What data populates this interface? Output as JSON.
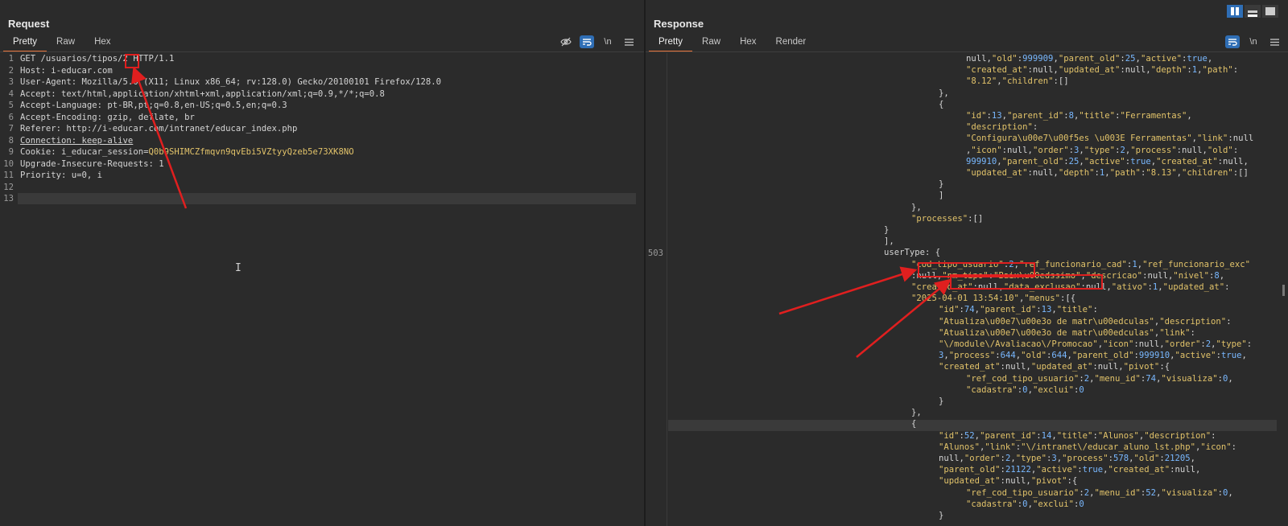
{
  "request": {
    "title": "Request",
    "tabs": [
      "Pretty",
      "Raw",
      "Hex"
    ],
    "icons": [
      "hide-icon",
      "wrap-icon",
      "newline-icon",
      "menu-icon"
    ],
    "newline_label": "\\n",
    "lines": [
      {
        "n": "1",
        "t": "GET /usuarios/tipos/2 HTTP/1.1"
      },
      {
        "n": "2",
        "t": "Host: i-educar.com"
      },
      {
        "n": "3",
        "t": "User-Agent: Mozilla/5.0 (X11; Linux x86_64; rv:128.0) Gecko/20100101 Firefox/128.0"
      },
      {
        "n": "4",
        "t": "Accept: text/html,application/xhtml+xml,application/xml;q=0.9,*/*;q=0.8"
      },
      {
        "n": "5",
        "t": "Accept-Language: pt-BR,pt;q=0.8,en-US;q=0.5,en;q=0.3"
      },
      {
        "n": "6",
        "t": "Accept-Encoding: gzip, deflate, br"
      },
      {
        "n": "7",
        "t": "Referer: http://i-educar.com/intranet/educar_index.php"
      },
      {
        "n": "8",
        "t": "Connection: keep-alive"
      },
      {
        "n": "9",
        "t": "Cookie: i_educar_session=",
        "v": "Q0b9SHIMCZfmqvn9qvEbi5VZtyyQzeb5e73XK8NO"
      },
      {
        "n": "10",
        "t": "Upgrade-Insecure-Requests: 1"
      },
      {
        "n": "11",
        "t": "Priority: u=0, i"
      },
      {
        "n": "12",
        "t": ""
      },
      {
        "n": "13",
        "t": ""
      }
    ]
  },
  "response": {
    "title": "Response",
    "tabs": [
      "Pretty",
      "Raw",
      "Hex",
      "Render"
    ],
    "newline_label": "\\n",
    "line_number": "503",
    "lines": [
      "null,\"old\":999909,\"parent_old\":25,\"active\":true,",
      "\"created_at\":null,\"updated_at\":null,\"depth\":1,\"path\":",
      "\"8.12\",\"children\":[]",
      "},",
      "{",
      "\"id\":13,\"parent_id\":8,\"title\":\"Ferramentas\",",
      "\"description\":",
      "\"Configura\\u00e7\\u00f5es \\u003E Ferramentas\",\"link\":null",
      ",\"icon\":null,\"order\":3,\"type\":2,\"process\":null,\"old\":",
      "999910,\"parent_old\":25,\"active\":true,\"created_at\":null,",
      "\"updated_at\":null,\"depth\":1,\"path\":\"8.13\",\"children\":[]",
      "}",
      "]",
      "},",
      "\"processes\":[]",
      "}",
      "],",
      "userType: {",
      "\"cod_tipo_usuario\":2,\"ref_funcionario_cad\":1,\"ref_funcionario_exc\"",
      ":null,\"nm_tipo\":\"Baix\\u00edssimo\",\"descricao\":null,\"nivel\":8,",
      "\"created_at\":null,\"data_exclusao\":null,\"ativo\":1,\"updated_at\":",
      "\"2025-04-01 13:54:10\",\"menus\":[{",
      "\"id\":74,\"parent_id\":13,\"title\":",
      "\"Atualiza\\u00e7\\u00e3o de matr\\u00edculas\",\"description\":",
      "\"Atualiza\\u00e7\\u00e3o de matr\\u00edculas\",\"link\":",
      "\"\\/module\\/Avaliacao\\/Promocao\",\"icon\":null,\"order\":2,\"type\":",
      "3,\"process\":644,\"old\":644,\"parent_old\":999910,\"active\":true,",
      "\"created_at\":null,\"updated_at\":null,\"pivot\":{",
      "\"ref_cod_tipo_usuario\":2,\"menu_id\":74,\"visualiza\":0,",
      "\"cadastra\":0,\"exclui\":0",
      "}",
      "},",
      "{",
      "\"id\":52,\"parent_id\":14,\"title\":\"Alunos\",\"description\":",
      "\"Alunos\",\"link\":\"\\/intranet\\/educar_aluno_lst.php\",\"icon\":",
      "null,\"order\":2,\"type\":3,\"process\":578,\"old\":21205,",
      "\"parent_old\":21122,\"active\":true,\"created_at\":null,",
      "\"updated_at\":null,\"pivot\":{",
      "\"ref_cod_tipo_usuario\":2,\"menu_id\":52,\"visualiza\":0,",
      "\"cadastra\":0,\"exclui\":0",
      "}"
    ]
  },
  "colors": {
    "accent_tab": "#e8743b",
    "annotation_red": "#e01f1f",
    "toggle_blue": "#2f6eb5",
    "json_key": "#e2c36a",
    "json_number": "#79b8ff"
  }
}
